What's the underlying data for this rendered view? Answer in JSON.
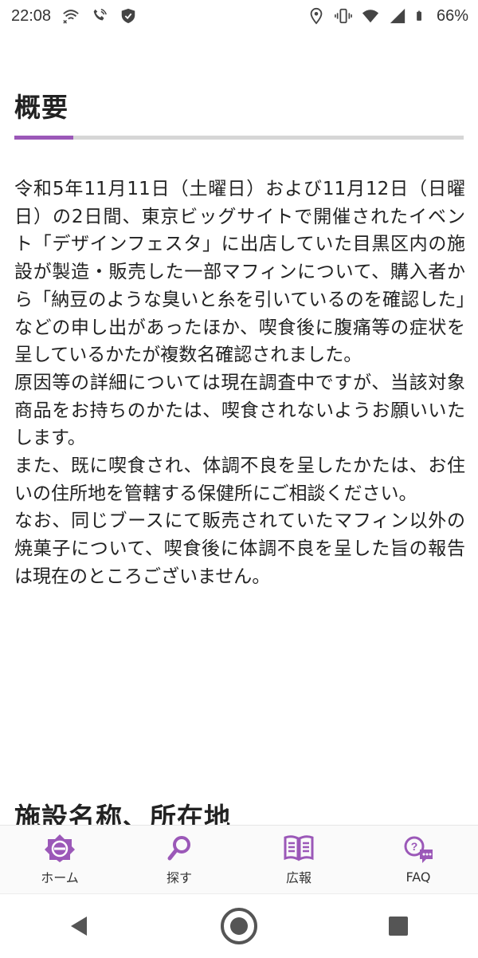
{
  "status_bar": {
    "time": "22:08",
    "battery": "66%",
    "icons_left": [
      "wifi-x-icon",
      "call-on-icon",
      "shield-icon"
    ],
    "icons_right": [
      "location-icon",
      "vibrate-icon",
      "wifi-icon",
      "signal-icon",
      "battery-icon"
    ]
  },
  "section1": {
    "title": "概要",
    "paragraphs": [
      "令和5年11月11日（土曜日）および11月12日（日曜日）の2日間、東京ビッグサイトで開催されたイベント「デザインフェスタ」に出店していた目黒区内の施設が製造・販売した一部マフィンについて、購入者から「納豆のような臭いと糸を引いているのを確認した」などの申し出があったほか、喫食後に腹痛等の症状を呈しているかたが複数名確認されました。",
      "原因等の詳細については現在調査中ですが、当該対象商品をお持ちのかたは、喫食されないようお願いいたします。",
      "また、既に喫食され、体調不良を呈したかたは、お住いの住所地を管轄する保健所にご相談ください。",
      "なお、同じブースにて販売されていたマフィン以外の焼菓子について、喫食後に体調不良を呈した旨の報告は現在のところございません。"
    ]
  },
  "section2": {
    "title": "施設名称、所在地"
  },
  "bottom_nav": {
    "items": [
      {
        "label": "ホーム",
        "icon": "home-emblem-icon"
      },
      {
        "label": "探す",
        "icon": "search-icon"
      },
      {
        "label": "広報",
        "icon": "book-icon"
      },
      {
        "label": "FAQ",
        "icon": "faq-chat-icon"
      }
    ]
  },
  "colors": {
    "accent": "#9b58b8",
    "rule": "#d6d6d6",
    "text": "#222222"
  }
}
